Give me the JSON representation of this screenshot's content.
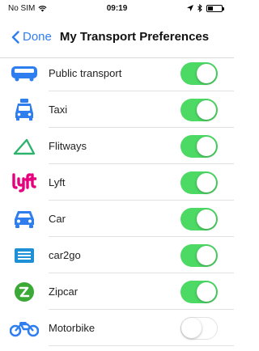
{
  "status_bar": {
    "carrier": "No SIM",
    "time": "09:19"
  },
  "nav": {
    "back_label": "Done",
    "title": "My Transport Preferences"
  },
  "colors": {
    "accent": "#2f7ef0",
    "toggle_on": "#4cd964",
    "icon_blue": "#2f7ef0",
    "lyft_pink": "#e6007e",
    "flitways_green": "#2db36b",
    "zipcar_green": "#3aa935"
  },
  "preferences": [
    {
      "label": "Public transport",
      "icon": "bus-icon",
      "enabled": true
    },
    {
      "label": "Taxi",
      "icon": "taxi-icon",
      "enabled": true
    },
    {
      "label": "Flitways",
      "icon": "flitways-icon",
      "enabled": true
    },
    {
      "label": "Lyft",
      "icon": "lyft-icon",
      "enabled": true
    },
    {
      "label": "Car",
      "icon": "car-icon",
      "enabled": true
    },
    {
      "label": "car2go",
      "icon": "car2go-icon",
      "enabled": true
    },
    {
      "label": "Zipcar",
      "icon": "zipcar-icon",
      "enabled": true
    },
    {
      "label": "Motorbike",
      "icon": "motorbike-icon",
      "enabled": false
    }
  ]
}
